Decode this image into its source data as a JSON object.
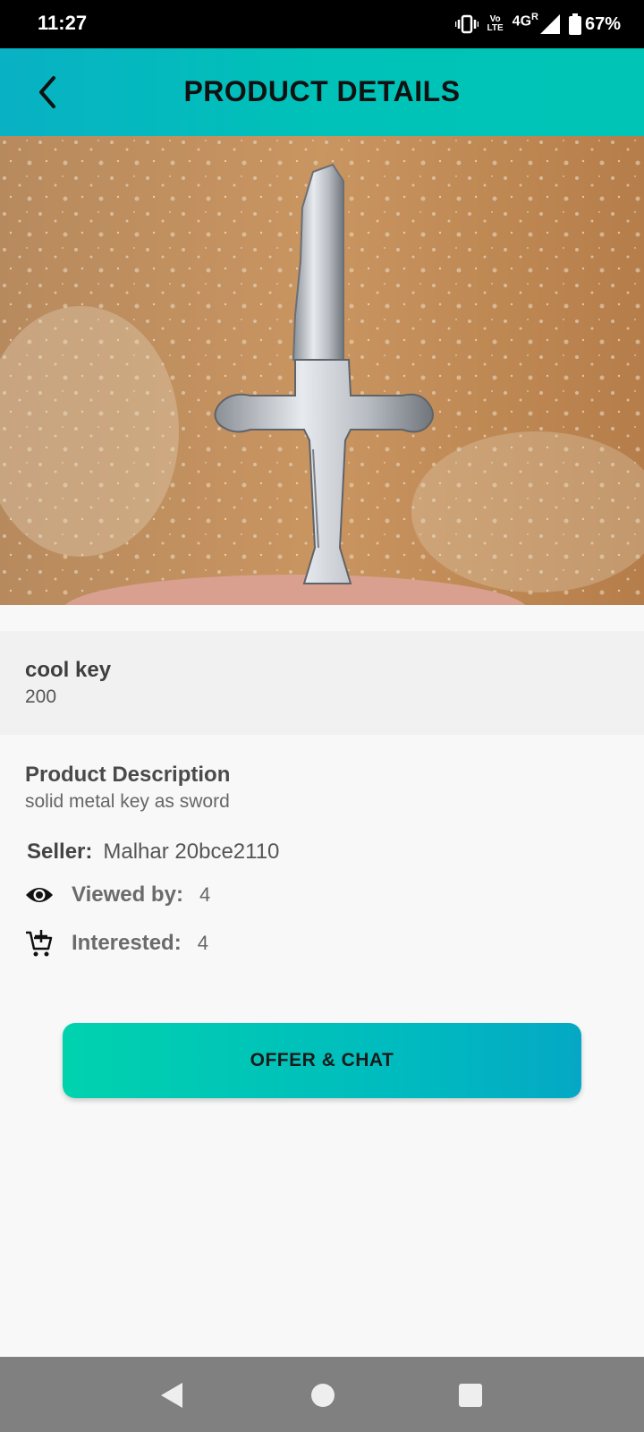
{
  "status_bar": {
    "time": "11:27",
    "volte_line1": "Vo",
    "volte_line2": "LTE",
    "network": "4G",
    "roaming": "R",
    "battery": "67%",
    "icons": [
      "vibrate-icon",
      "volte-icon",
      "signal-icon",
      "battery-icon"
    ]
  },
  "header": {
    "title": "PRODUCT DETAILS",
    "back_icon": "chevron-left-icon"
  },
  "product": {
    "name": "cool key",
    "price": "200",
    "description_title": "Product Description",
    "description": "solid metal key as sword"
  },
  "seller": {
    "label": "Seller:",
    "value": "Malhar 20bce2110"
  },
  "stats": {
    "viewed_label": "Viewed by:",
    "viewed_value": "4",
    "viewed_icon": "eye-icon",
    "interested_label": "Interested:",
    "interested_value": "4",
    "interested_icon": "add-to-cart-icon"
  },
  "actions": {
    "offer_chat_label": "OFFER & CHAT"
  },
  "colors": {
    "accent_start": "#00d2ae",
    "accent_end": "#05a8c4",
    "header_bg": "#00c2b8"
  }
}
